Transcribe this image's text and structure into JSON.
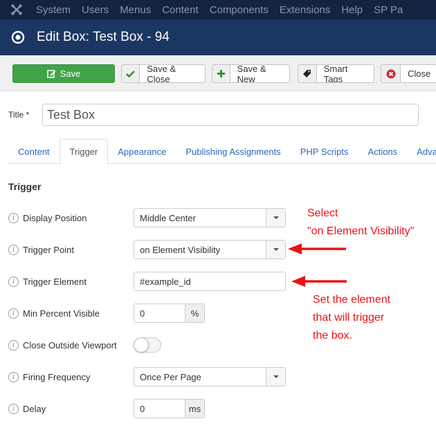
{
  "topnav": {
    "items": [
      "System",
      "Users",
      "Menus",
      "Content",
      "Components",
      "Extensions",
      "Help",
      "SP Pa"
    ]
  },
  "header": {
    "title": "Edit Box: Test Box - 94"
  },
  "toolbar": {
    "save_label": "Save",
    "save_close_label": "Save & Close",
    "save_new_label": "Save & New",
    "smart_tags_label": "Smart Tags",
    "close_label": "Close"
  },
  "title_field": {
    "label": "Title *",
    "value": "Test Box"
  },
  "tabs": [
    {
      "label": "Content"
    },
    {
      "label": "Trigger",
      "active": true
    },
    {
      "label": "Appearance"
    },
    {
      "label": "Publishing Assignments"
    },
    {
      "label": "PHP Scripts"
    },
    {
      "label": "Actions"
    },
    {
      "label": "Adva"
    }
  ],
  "section": {
    "title": "Trigger"
  },
  "fields": {
    "display_position": {
      "label": "Display Position",
      "value": "Middle Center"
    },
    "trigger_point": {
      "label": "Trigger Point",
      "value": "on Element Visibility"
    },
    "trigger_element": {
      "label": "Trigger Element",
      "value": "#example_id"
    },
    "min_percent_visible": {
      "label": "Min Percent Visible",
      "value": "0",
      "unit": "%"
    },
    "close_outside_viewport": {
      "label": "Close Outside Viewport",
      "enabled": false
    },
    "firing_frequency": {
      "label": "Firing Frequency",
      "value": "Once Per Page"
    },
    "delay": {
      "label": "Delay",
      "value": "0",
      "unit": "ms"
    }
  },
  "annotations": {
    "select_line1": "Select",
    "select_line2": "\"on Element Visibility\"",
    "set_line1": "Set the element",
    "set_line2": "that will trigger",
    "set_line3": "the box."
  },
  "colors": {
    "topnav_bg": "#132441",
    "header_bg": "#1c3664",
    "save_green": "#41a347",
    "link_blue": "#2a69b8",
    "annotation_red": "#ee1111"
  }
}
